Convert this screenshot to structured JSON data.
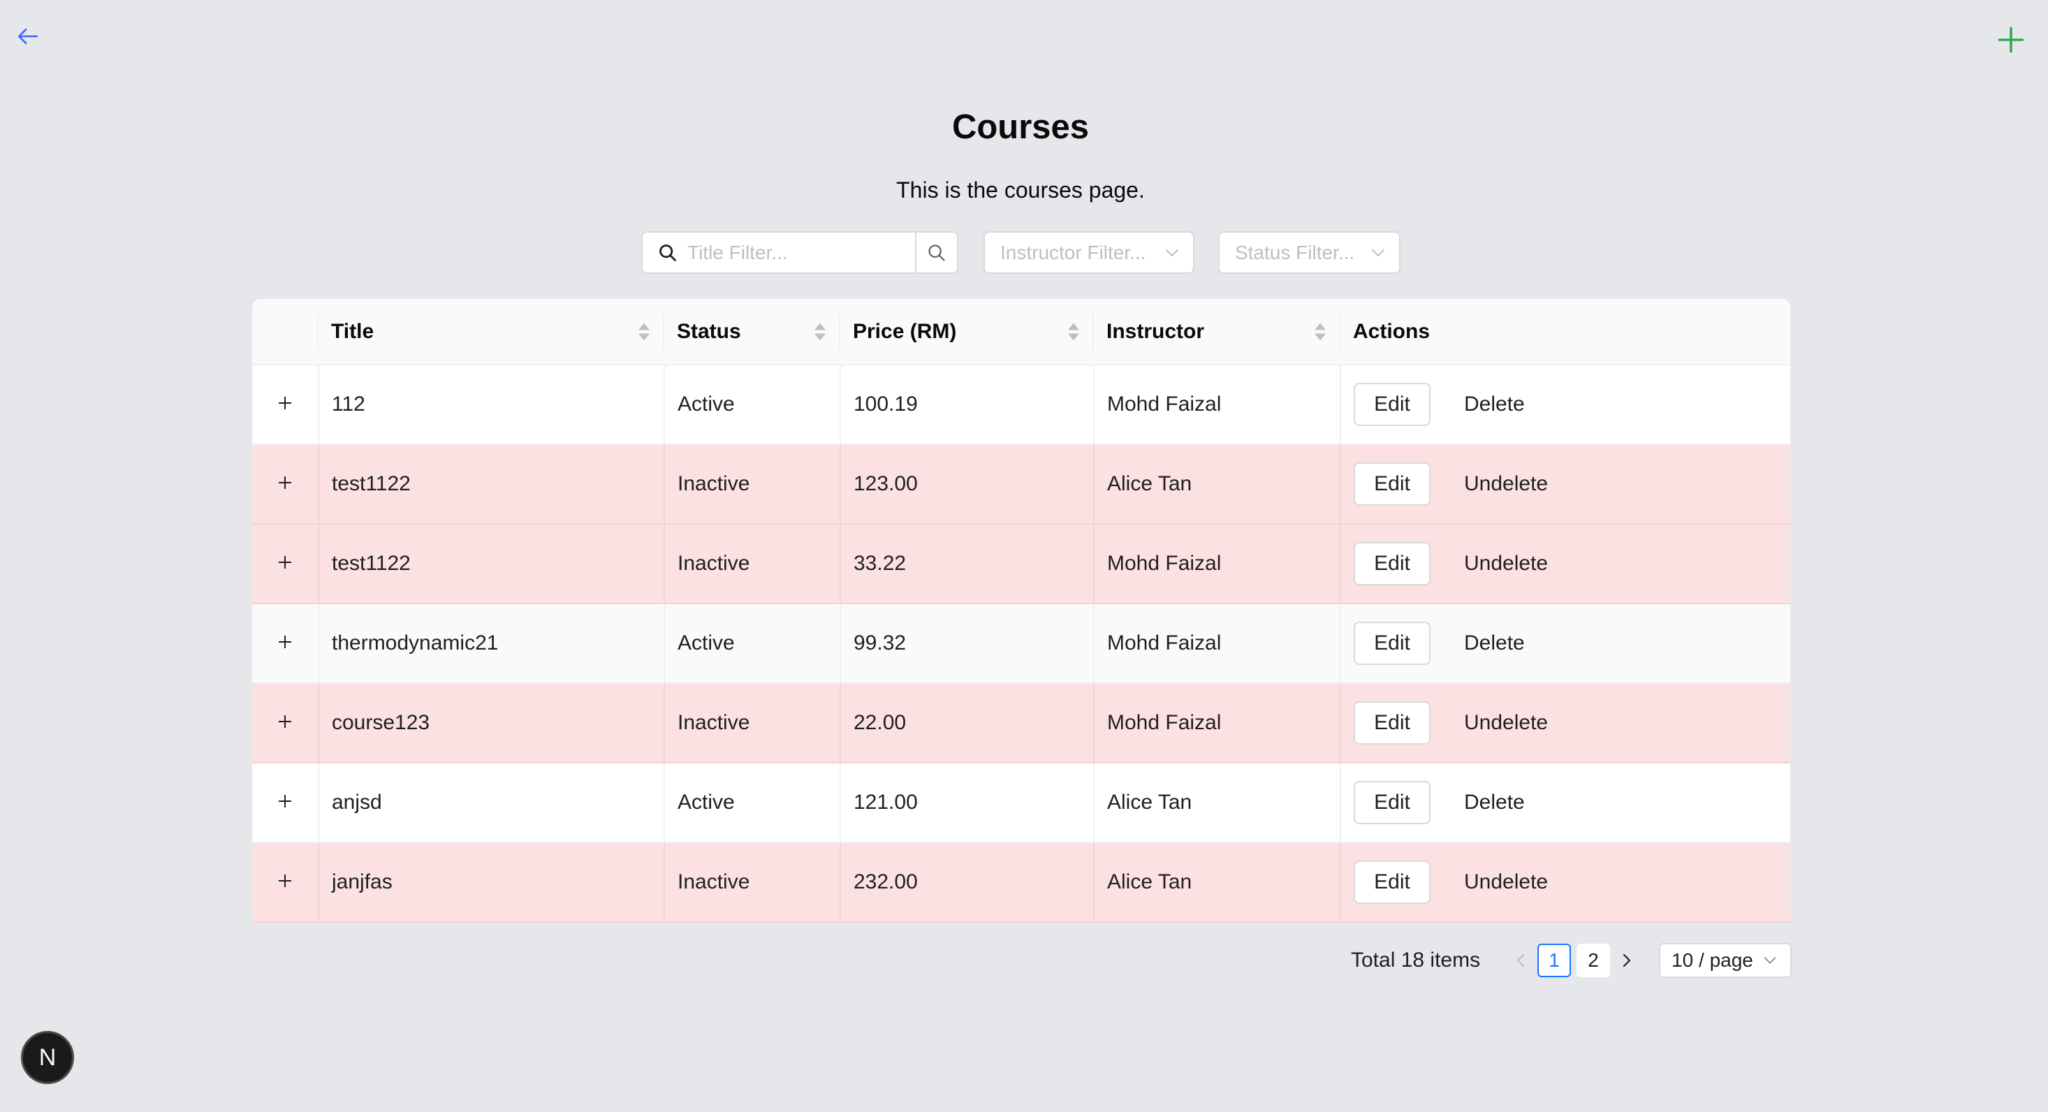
{
  "header": {
    "title": "Courses",
    "subtitle": "This is the courses page."
  },
  "icons": {
    "back": "arrow-left-icon",
    "add": "plus-icon",
    "search": "search-icon",
    "dropdown": "chevron-down-icon",
    "expand": "plus-icon",
    "sort": "sort-icon"
  },
  "colors": {
    "accent_blue": "#1677ff",
    "add_green": "#22a845",
    "back_blue": "#4364f7",
    "inactive_row": "#fbe1e2",
    "background": "#e5e7eb"
  },
  "filters": {
    "title_placeholder": "Title Filter...",
    "instructor_placeholder": "Instructor Filter...",
    "status_placeholder": "Status Filter..."
  },
  "table": {
    "columns": [
      "Title",
      "Status",
      "Price (RM)",
      "Instructor",
      "Actions"
    ],
    "rows": [
      {
        "title": "112",
        "status": "Active",
        "price": "100.19",
        "instructor": "Mohd Faizal",
        "edit": "Edit",
        "action": "Delete"
      },
      {
        "title": "test1122",
        "status": "Inactive",
        "price": "123.00",
        "instructor": "Alice Tan",
        "edit": "Edit",
        "action": "Undelete"
      },
      {
        "title": "test1122",
        "status": "Inactive",
        "price": "33.22",
        "instructor": "Mohd Faizal",
        "edit": "Edit",
        "action": "Undelete"
      },
      {
        "title": "thermodynamic21",
        "status": "Active",
        "price": "99.32",
        "instructor": "Mohd Faizal",
        "edit": "Edit",
        "action": "Delete"
      },
      {
        "title": "course123",
        "status": "Inactive",
        "price": "22.00",
        "instructor": "Mohd Faizal",
        "edit": "Edit",
        "action": "Undelete"
      },
      {
        "title": "anjsd",
        "status": "Active",
        "price": "121.00",
        "instructor": "Alice Tan",
        "edit": "Edit",
        "action": "Delete"
      },
      {
        "title": "janjfas",
        "status": "Inactive",
        "price": "232.00",
        "instructor": "Alice Tan",
        "edit": "Edit",
        "action": "Undelete"
      }
    ]
  },
  "pagination": {
    "total": "Total 18 items",
    "pages": [
      "1",
      "2"
    ],
    "current": "1",
    "page_size": "10 / page"
  },
  "badge": {
    "letter": "N"
  }
}
